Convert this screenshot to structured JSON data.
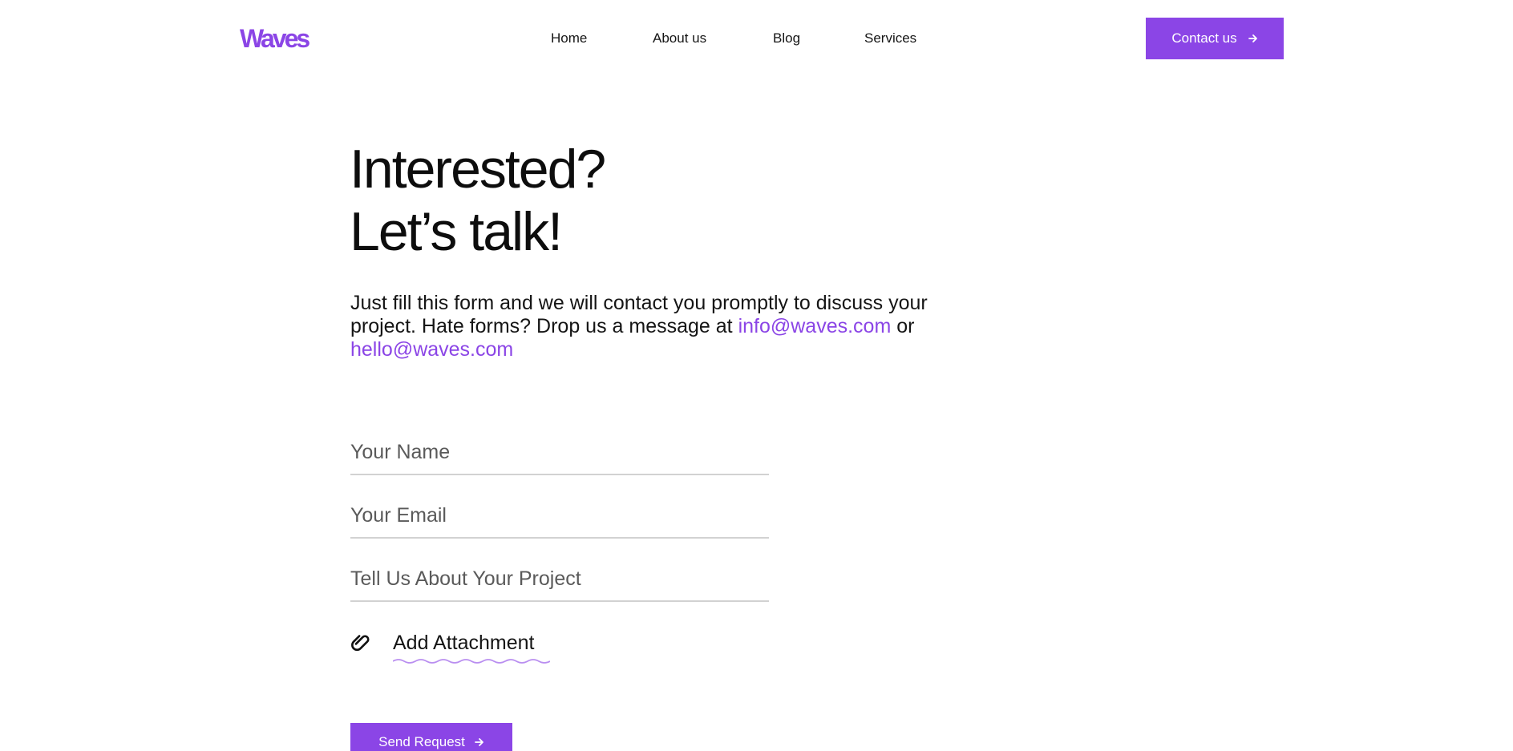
{
  "header": {
    "logo": "Waves",
    "nav": [
      {
        "label": "Home"
      },
      {
        "label": "About us"
      },
      {
        "label": "Blog"
      },
      {
        "label": "Services"
      }
    ],
    "contact_button": "Contact us"
  },
  "hero": {
    "headline_line1": "Interested?",
    "headline_line2": "Let’s talk!",
    "intro_text": "Just fill this form and we will contact you promptly to discuss your project. Hate forms? Drop us a message at",
    "email_primary": "info@waves.com",
    "connector": "or",
    "email_secondary": "hello@waves.com"
  },
  "form": {
    "name_placeholder": "Your Name",
    "email_placeholder": "Your Email",
    "project_placeholder": "Tell Us About Your Project",
    "attachment_label": "Add Attachment",
    "submit_label": "Send Request"
  },
  "icons": {
    "arrow": "arrow-right-icon",
    "attachment": "paperclip-icon"
  },
  "colors": {
    "accent": "#8b45e6",
    "text": "#111111",
    "field_border": "#d2d2d2",
    "wave_underline": "#b98ef0"
  }
}
